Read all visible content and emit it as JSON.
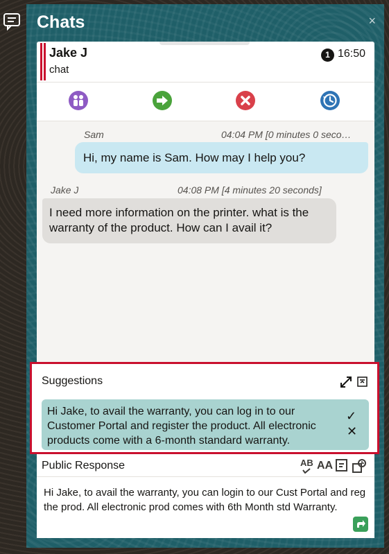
{
  "panel": {
    "title": "Chats",
    "close_label": "×"
  },
  "contact": {
    "name": "Jake J",
    "channel": "chat",
    "unread_count": "1",
    "time": "16:50"
  },
  "toolbar": {
    "icons": [
      "conference-icon",
      "transfer-icon",
      "end-chat-icon",
      "history-icon"
    ],
    "colors": {
      "conference": "#8e5bc4",
      "transfer": "#4aa33b",
      "end": "#d9404a",
      "history": "#2f74b5"
    }
  },
  "messages": [
    {
      "sender": "Sam",
      "timestamp": "04:04 PM [0 minutes 0 seco…",
      "text": "Hi, my name is Sam. How may I help you?",
      "role": "agent"
    },
    {
      "sender": "Jake J",
      "timestamp": "04:08 PM [4 minutes 20 seconds]",
      "text": "I need more information on the printer. what is the warranty of the product. How can I avail it?",
      "role": "customer"
    }
  ],
  "suggestions": {
    "title": "Suggestions",
    "text": "Hi Jake, to avail the warranty, you can log in to our Customer Portal and register the product. All electronic products come with a 6-month standard warranty.",
    "accept_label": "✓",
    "reject_label": "✕"
  },
  "response": {
    "title": "Public Response",
    "tools": {
      "spell": "AB",
      "font": "AA"
    },
    "text": "Hi Jake, to avail the warranty, you can login to our Cust Portal and reg the prod. All electronic prod comes with 6th Month std Warranty."
  },
  "colors": {
    "accent_red": "#c9102e",
    "agent_bubble": "#c9e8f2",
    "customer_bubble": "#e0dedb",
    "suggestion_bg": "#a9d3d0",
    "panel_bg": "#1f5f68"
  }
}
